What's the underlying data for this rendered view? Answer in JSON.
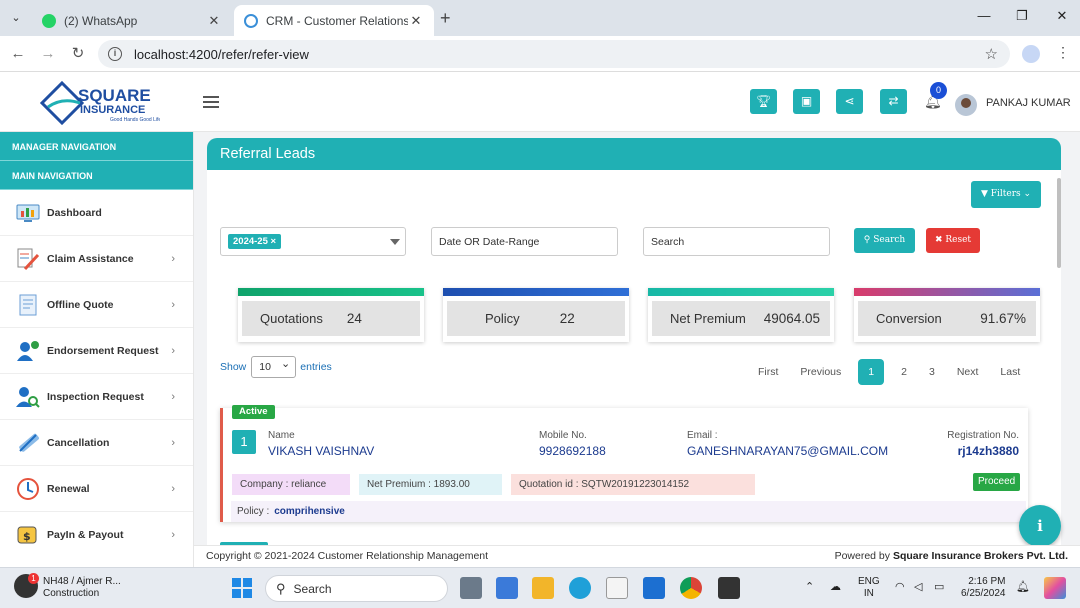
{
  "browser": {
    "tabs": [
      {
        "title": "(2) WhatsApp",
        "active": false
      },
      {
        "title": "CRM - Customer Relationship M",
        "active": true
      }
    ],
    "url": "localhost:4200/refer/refer-view"
  },
  "header": {
    "logo_text": "SQUARE INSURANCE",
    "logo_tagline": "Good Hands Good Life",
    "notification_count": "0",
    "user_name": "PANKAJ KUMAR",
    "icons": [
      "trophy-icon",
      "book-icon",
      "share-icon",
      "exchange-icon"
    ]
  },
  "sidebar": {
    "section1": "MANAGER NAVIGATION",
    "section2": "MAIN NAVIGATION",
    "items": [
      {
        "label": "Dashboard",
        "icon": "dashboard-icon"
      },
      {
        "label": "Claim Assistance",
        "icon": "claim-icon"
      },
      {
        "label": "Offline Quote",
        "icon": "quote-icon"
      },
      {
        "label": "Endorsement Request",
        "icon": "endorsement-icon"
      },
      {
        "label": "Inspection Request",
        "icon": "inspection-icon"
      },
      {
        "label": "Cancellation",
        "icon": "cancellation-icon"
      },
      {
        "label": "Renewal",
        "icon": "renewal-icon"
      },
      {
        "label": "PayIn & Payout",
        "icon": "payout-icon"
      }
    ]
  },
  "main": {
    "title": "Referral Leads",
    "filters_label": "Filters",
    "fiscal_year_tag": "2024-25",
    "date_placeholder": "Date OR Date-Range",
    "search_placeholder": "Search",
    "search_button": "Search",
    "reset_button": "Reset",
    "stats": [
      {
        "label": "Quotations",
        "value": "24",
        "color": "#0fa36b"
      },
      {
        "label": "Policy",
        "value": "22",
        "color": "#1e4fb0"
      },
      {
        "label": "Net Premium",
        "value": "49064.05",
        "color": "#17b8a6"
      },
      {
        "label": "Conversion",
        "value": "91.67%",
        "color": "#d93b6b"
      }
    ],
    "show_label": "Show",
    "entries_value": "10",
    "entries_label": "entries",
    "pagination": [
      "First",
      "Previous",
      "1",
      "2",
      "3",
      "Next",
      "Last"
    ],
    "current_page": "1",
    "lead": {
      "status": "Active",
      "number": "1",
      "name_label": "Name",
      "name": "VIKASH VAISHNAV",
      "mobile_label": "Mobile No.",
      "mobile": "9928692188",
      "email_label": "Email :",
      "email": "GANESHNARAYAN75@GMAIL.COM",
      "reg_label": "Registration No.",
      "reg": "rj14zh3880",
      "company": "Company : reliance",
      "net_premium": "Net Premium : 1893.00",
      "quotation_id": "Quotation id : SQTW20191223014152",
      "proceed_label": "Proceed",
      "policy_label": "Policy :",
      "policy_value": "comprihensive"
    }
  },
  "footer": {
    "copyright": "Copyright © 2021-2024 Customer Relationship Management",
    "powered_prefix": "Powered by ",
    "powered_company": "Square Insurance Brokers Pvt. Ltd."
  },
  "taskbar": {
    "weather_line1": "NH48 / Ajmer R...",
    "weather_line2": "Construction",
    "weather_badge": "1",
    "search_label": "Search",
    "lang_line1": "ENG",
    "lang_line2": "IN",
    "time": "2:16 PM",
    "date": "6/25/2024"
  }
}
